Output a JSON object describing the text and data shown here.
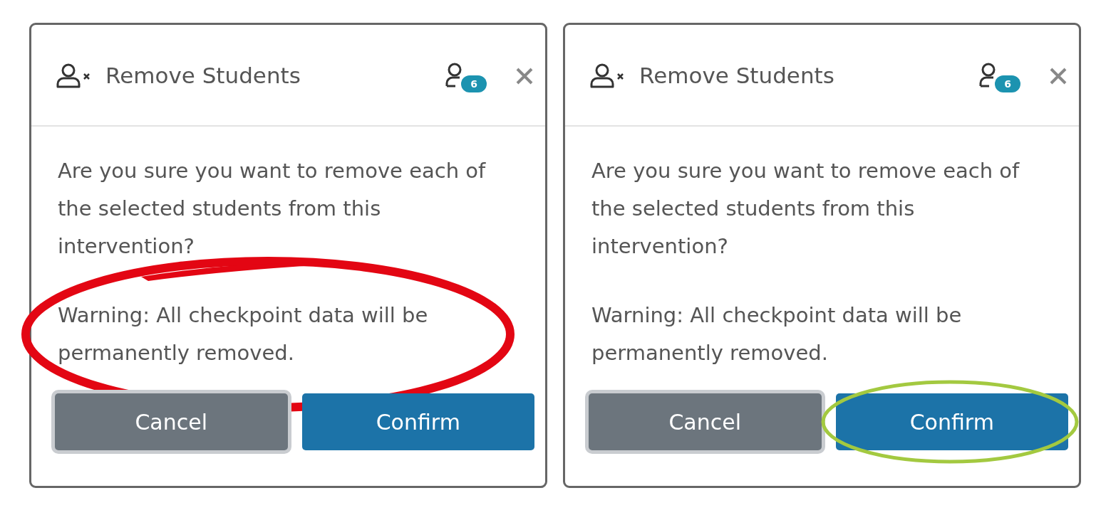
{
  "panels": [
    {
      "title": "Remove Students",
      "badge": "6",
      "message": "Are you sure you want to remove each of the selected students from this intervention?",
      "warning": {
        "text": "Warning: All checkpoint data will be permanently removed.",
        "circled": true
      },
      "buttons": [
        {
          "label": "Cancel",
          "kind": "secondary",
          "circled": false
        },
        {
          "label": "Confirm",
          "kind": "primary",
          "circled": false
        }
      ],
      "color": "#e30613"
    },
    {
      "title": "Remove Students",
      "badge": "6",
      "message": "Are you sure you want to remove each of the selected students from this intervention?",
      "warning": {
        "text": "Warning: All checkpoint data will be permanently removed.",
        "circled": false
      },
      "buttons": [
        {
          "label": "Cancel",
          "kind": "secondary",
          "circled": false
        },
        {
          "label": "Confirm",
          "kind": "primary",
          "circled": true
        }
      ],
      "color": "#a3c940"
    }
  ]
}
